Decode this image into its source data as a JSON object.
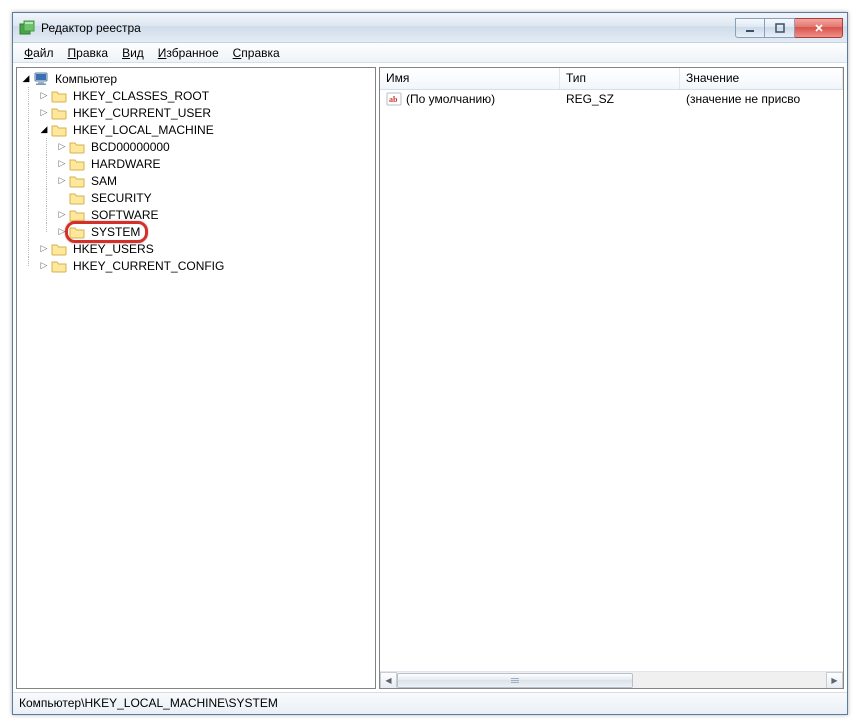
{
  "window": {
    "title": "Редактор реестра"
  },
  "menu": {
    "file": {
      "u": "Ф",
      "rest": "айл"
    },
    "edit": {
      "u": "П",
      "rest": "равка"
    },
    "view": {
      "u": "В",
      "rest": "ид"
    },
    "fav": {
      "u": "И",
      "rest": "збранное"
    },
    "help": {
      "u": "С",
      "rest": "правка"
    }
  },
  "tree": {
    "root": "Компьютер",
    "hkcr": "HKEY_CLASSES_ROOT",
    "hkcu": "HKEY_CURRENT_USER",
    "hklm": "HKEY_LOCAL_MACHINE",
    "hklm_children": {
      "bcd": "BCD00000000",
      "hw": "HARDWARE",
      "sam": "SAM",
      "sec": "SECURITY",
      "sw": "SOFTWARE",
      "sys": "SYSTEM"
    },
    "hku": "HKEY_USERS",
    "hkcc": "HKEY_CURRENT_CONFIG"
  },
  "list": {
    "headers": {
      "name": "Имя",
      "type": "Тип",
      "value": "Значение"
    },
    "row0": {
      "name": "(По умолчанию)",
      "type": "REG_SZ",
      "value": "(значение не присво"
    }
  },
  "status": {
    "path": "Компьютер\\HKEY_LOCAL_MACHINE\\SYSTEM"
  },
  "glyph": {
    "tri_right": "▷",
    "tri_down": "◿",
    "tri_black_down": "◢",
    "left": "◀",
    "right_solid": "▶"
  }
}
